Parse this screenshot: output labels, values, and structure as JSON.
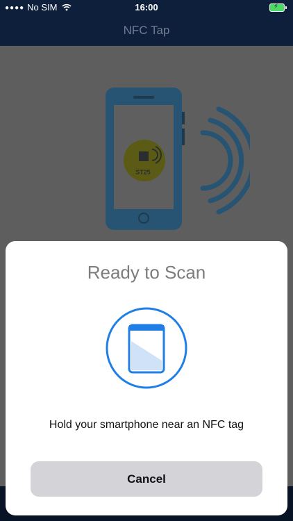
{
  "status_bar": {
    "carrier": "No SIM",
    "time": "16:00",
    "signal_icon": "signal-dots-icon",
    "wifi_icon": "wifi-icon",
    "battery_icon": "battery-charging-icon",
    "battery_color": "#4cd964"
  },
  "nav": {
    "title": "NFC Tap"
  },
  "background_illustration": {
    "tag_label": "ST25",
    "phone_color": "#1e6fa8",
    "tag_color": "#a6a41b"
  },
  "scan_sheet": {
    "title": "Ready to Scan",
    "icon": "phone-scan-icon",
    "accent_color": "#1f7fe6",
    "message": "Hold your smartphone near an NFC tag",
    "cancel_label": "Cancel"
  },
  "colors": {
    "nav_background": "#0d1f3a",
    "sheet_background": "#ffffff",
    "cancel_background": "#d4d4d8"
  }
}
